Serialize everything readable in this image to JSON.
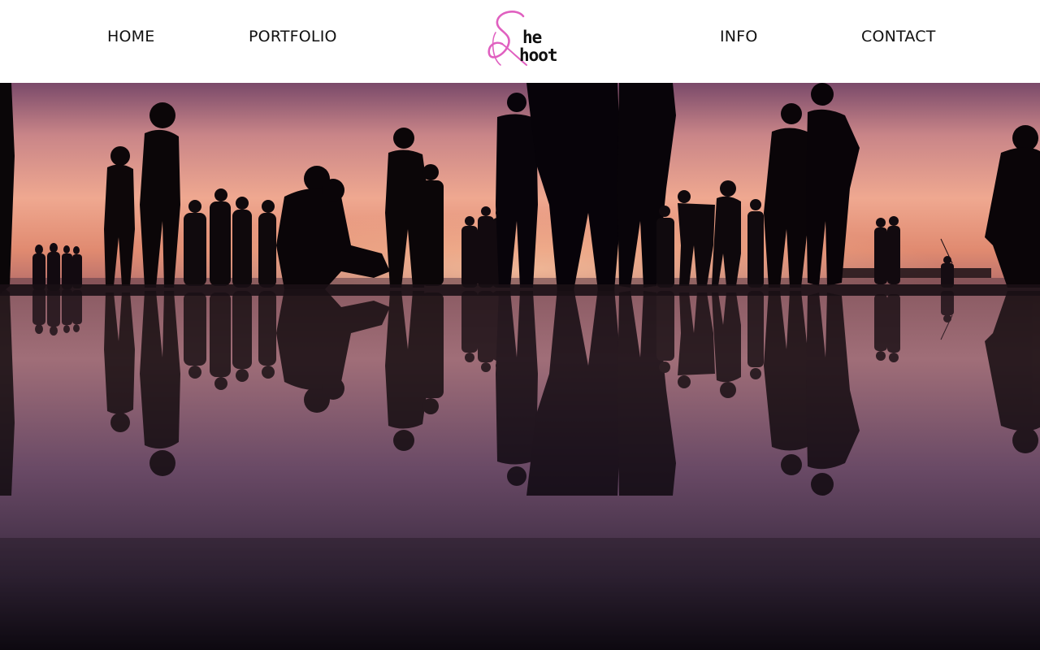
{
  "nav": {
    "left": [
      {
        "label": "HOME"
      },
      {
        "label": "PORTFOLIO"
      }
    ],
    "right": [
      {
        "label": "INFO"
      },
      {
        "label": "CONTACT"
      }
    ]
  },
  "logo": {
    "initial": "S",
    "word_top": "he",
    "word_bottom": "hoot",
    "accent_color": "#e060c0"
  },
  "hero": {
    "icon": "sunset-crowd-reflection-photo",
    "sky_colors": [
      "#7a4a70",
      "#e8a09a",
      "#f2b090"
    ]
  }
}
